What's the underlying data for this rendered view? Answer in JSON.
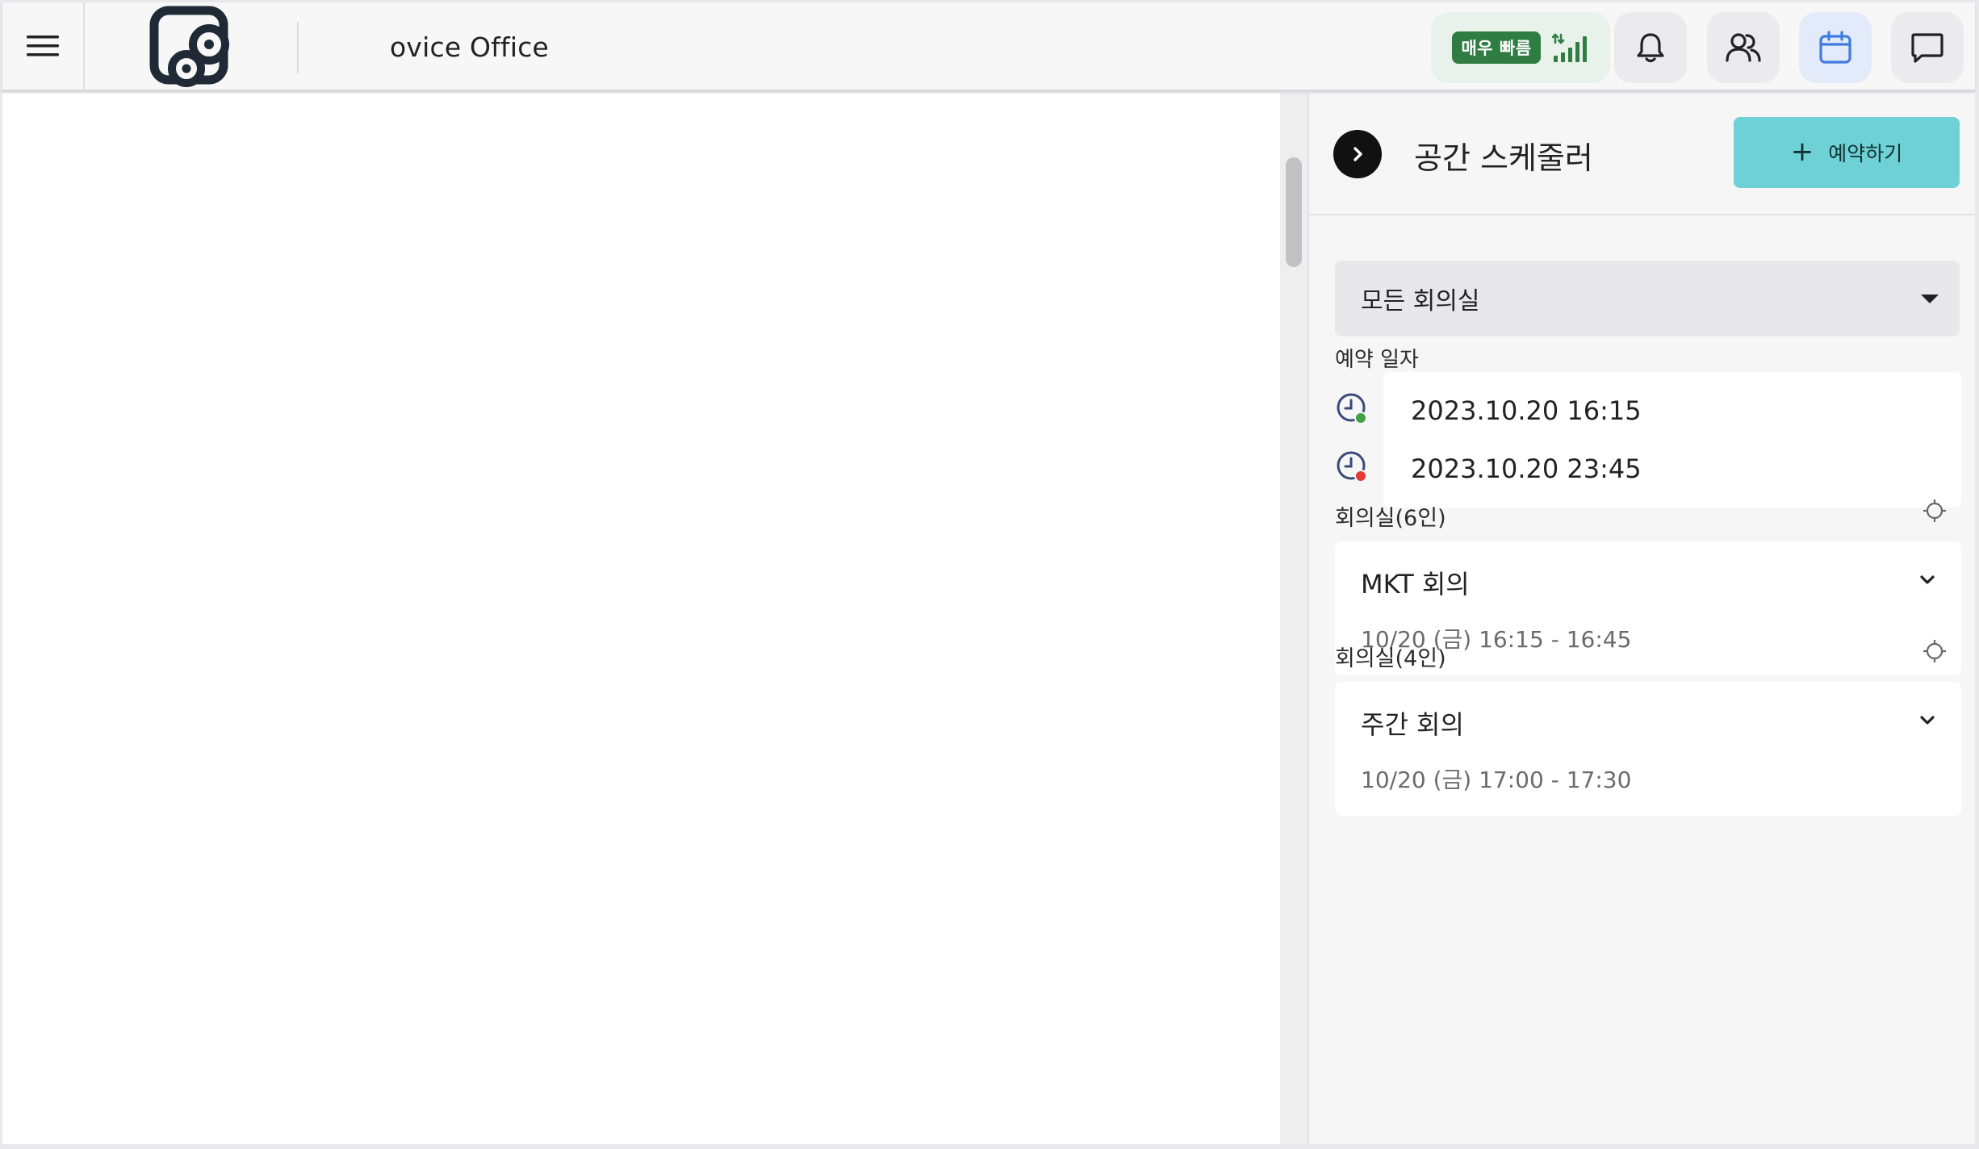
{
  "header": {
    "space_name": "ovice Office",
    "network_status": "매우 빠름",
    "colors": {
      "network_green": "#2f7d43",
      "active_blue": "#3f7be0"
    }
  },
  "panel": {
    "title": "공간 스케줄러",
    "reserve_button": "예약하기",
    "reserve_plus": "+",
    "room_filter": "모든 회의실",
    "date_section_label": "예약 일자",
    "start_datetime": "2023.10.20 16:15",
    "end_datetime": "2023.10.20 23:45",
    "accent_color": "#6ed1d6",
    "rooms": [
      {
        "name": "회의실(6인)",
        "meetings": [
          {
            "title": "MKT 회의",
            "time": "10/20 (금) 16:15 - 16:45"
          }
        ]
      },
      {
        "name": "회의실(4인)",
        "meetings": [
          {
            "title": "주간 회의",
            "time": "10/20 (금) 17:00 - 17:30"
          }
        ]
      }
    ]
  }
}
